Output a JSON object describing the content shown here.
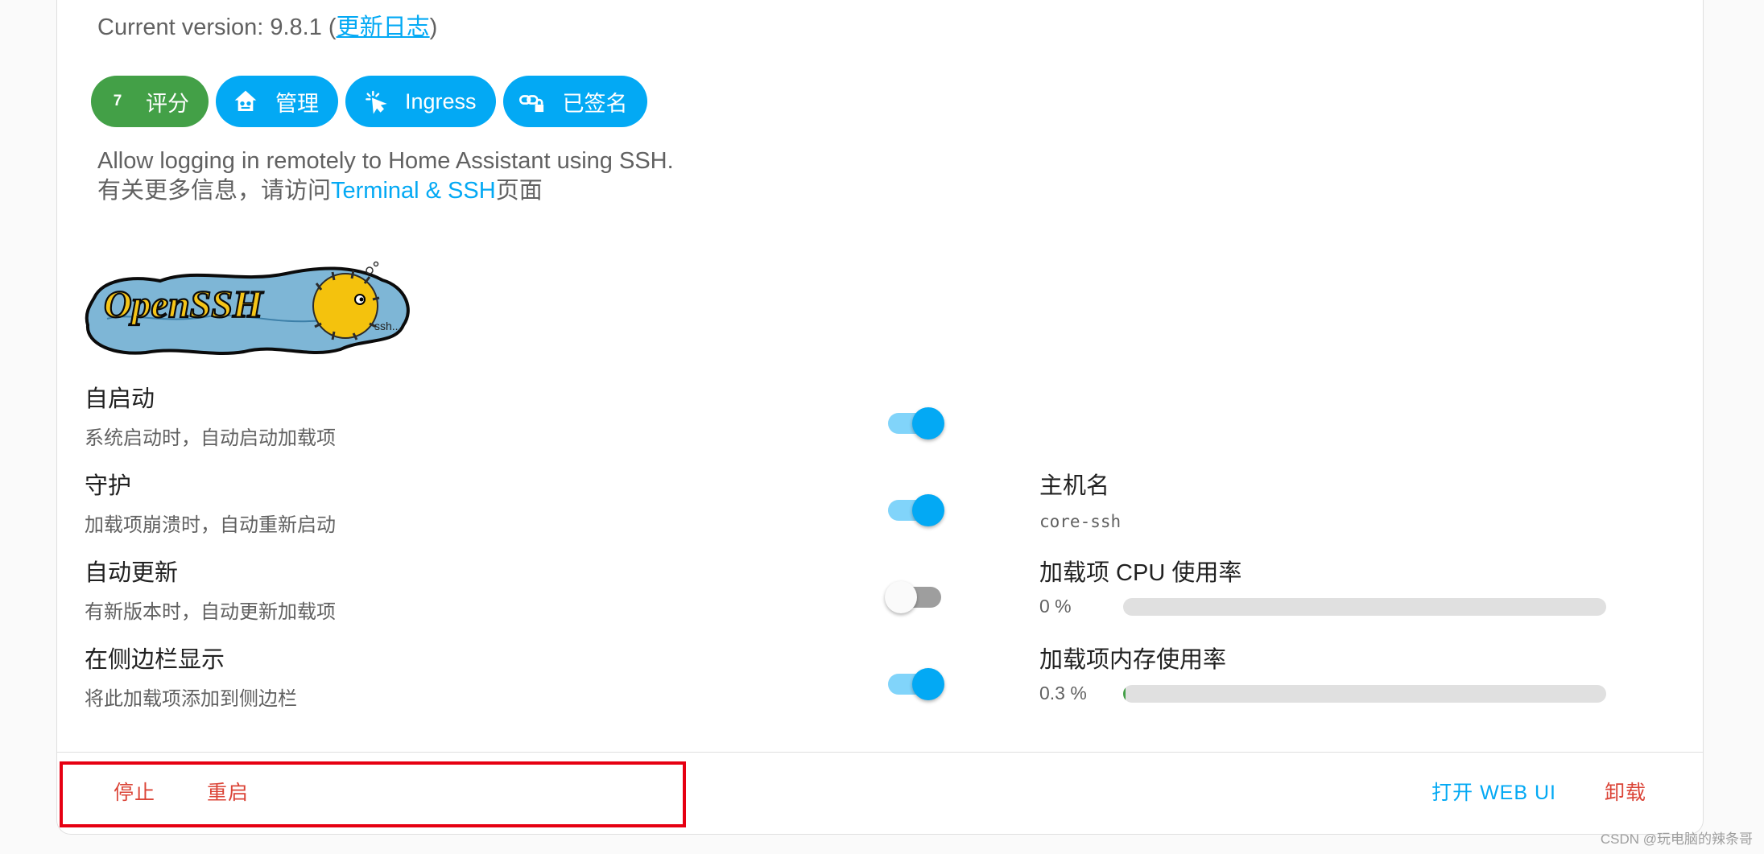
{
  "header": {
    "version_prefix": "Current version: 9.8.1 (",
    "changelog_link": "更新日志",
    "version_suffix": ")"
  },
  "chips": {
    "rating_value": "7",
    "rating_label": "评分",
    "manage_label": "管理",
    "ingress_label": "Ingress",
    "signed_label": "已签名"
  },
  "description": {
    "line1": "Allow logging in remotely to Home Assistant using SSH.",
    "line2_prefix": "有关更多信息，请访问",
    "line2_link": "Terminal & SSH",
    "line2_suffix": "页面"
  },
  "logo": {
    "text": "OpenSSH",
    "small_text": "ssh..."
  },
  "options": [
    {
      "title": "自启动",
      "subtitle": "系统启动时，自动启动加载项",
      "enabled": true
    },
    {
      "title": "守护",
      "subtitle": "加载项崩溃时，自动重新启动",
      "enabled": true
    },
    {
      "title": "自动更新",
      "subtitle": "有新版本时，自动更新加载项",
      "enabled": false
    },
    {
      "title": "在侧边栏显示",
      "subtitle": "将此加载项添加到侧边栏",
      "enabled": true
    }
  ],
  "info": {
    "hostname_label": "主机名",
    "hostname_value": "core-ssh",
    "cpu_label": "加载项 CPU 使用率",
    "cpu_value": "0 %",
    "cpu_percent": 0,
    "memory_label": "加载项内存使用率",
    "memory_value": "0.3 %",
    "memory_percent": 0.3
  },
  "actions": {
    "stop": "停止",
    "restart": "重启",
    "open_web_ui": "打开 WEB UI",
    "uninstall": "卸载"
  },
  "watermark": "CSDN @玩电脑的辣条哥",
  "colors": {
    "accent": "#03a9f4",
    "rating_green": "#43a047",
    "danger": "#db4437",
    "highlight_red": "#e60012"
  }
}
